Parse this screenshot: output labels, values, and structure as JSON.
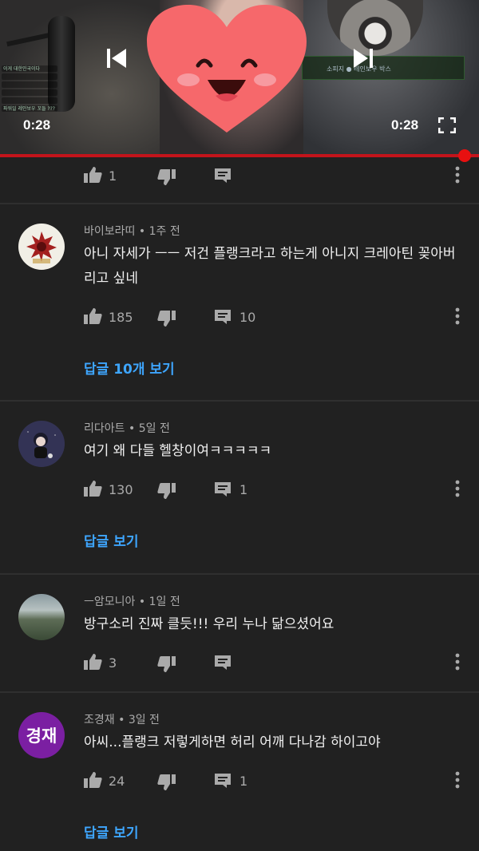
{
  "player": {
    "time_left": "0:28",
    "time_right": "0:28",
    "progress_fraction": 0.97,
    "banner_text": "소피지 ● 레인보우 박스",
    "chat_lines": [
      "이게 대한민국이다",
      "",
      "",
      "",
      "",
      "파워일 레인보우 꼬들 ???"
    ]
  },
  "top_actions": {
    "likes": "1"
  },
  "comments": [
    {
      "author": "바이보라띠",
      "time": "1주 전",
      "text": "아니 자세가 ㅡㅡ 저건 플랭크라고 하는게 아니지 크레아틴 꽂아버리고 싶네",
      "likes": "185",
      "replies": "10",
      "view_replies": "답글 10개 보기"
    },
    {
      "author": "리다아트",
      "time": "5일 전",
      "text": "여기 왜 다들 헬창이여ㅋㅋㅋㅋㅋ",
      "likes": "130",
      "replies": "1",
      "view_replies": "답글 보기"
    },
    {
      "author": "ㅡ암모니아",
      "time": "1일 전",
      "text": "방구소리 진짜 클듯!!! 우리 누나 닮으셨어요",
      "likes": "3",
      "replies": "",
      "view_replies": ""
    },
    {
      "author": "조경재",
      "avatar_text": "경재",
      "time": "3일 전",
      "text": "아씨...플랭크 저렇게하면 허리 어깨 다나감 하이고야",
      "likes": "24",
      "replies": "1",
      "view_replies": "답글 보기"
    }
  ],
  "meta_separator": " • ",
  "colors": {
    "accent_link": "#3ea6ff",
    "progress": "#c3141b",
    "background": "#212121",
    "avatar_purple": "#7b1fa2"
  },
  "icons": [
    "thumb-up-icon",
    "thumb-down-icon",
    "reply-icon",
    "more-vert-icon",
    "skip-previous-icon",
    "skip-next-icon",
    "fullscreen-icon"
  ]
}
